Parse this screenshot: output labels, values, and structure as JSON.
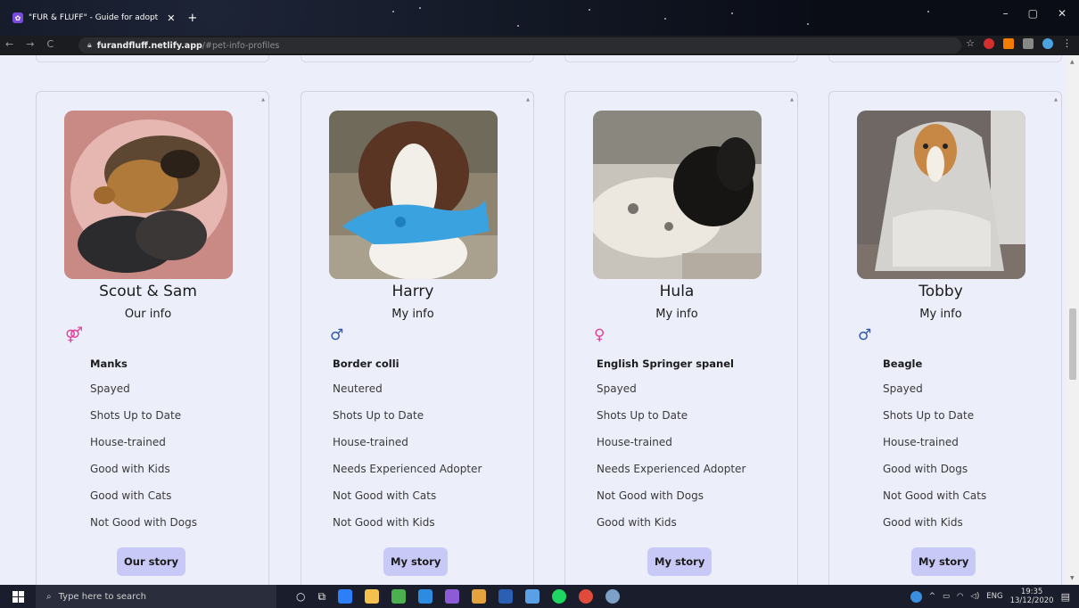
{
  "browser": {
    "tab_title": "\"FUR & FLUFF\" - Guide for adopt",
    "tab_close": "✕",
    "new_tab": "+",
    "url_host": "furandfluff.netlify.app",
    "url_path": "/#pet-info-profiles",
    "window_controls": [
      "–",
      "▢",
      "✕"
    ],
    "nav_icons": [
      "back-icon",
      "forward-icon",
      "reload-icon"
    ]
  },
  "pets": [
    {
      "name": "Scout & Sam",
      "info_title": "Our info",
      "gender_symbol": "⚤",
      "gender": "female-pair",
      "breed": "Manks",
      "traits": [
        "Spayed",
        "Shots Up to Date",
        "House-trained",
        "Good with Kids",
        "Good with Cats",
        "Not Good with Dogs"
      ],
      "story_label": "Our story"
    },
    {
      "name": "Harry",
      "info_title": "My info",
      "gender_symbol": "♂",
      "gender": "male",
      "breed": "Border colli",
      "traits": [
        "Neutered",
        "Shots Up to Date",
        "House-trained",
        "Needs Experienced Adopter",
        "Not Good with Cats",
        "Not Good with Kids"
      ],
      "story_label": "My story"
    },
    {
      "name": "Hula",
      "info_title": "My info",
      "gender_symbol": "♀",
      "gender": "female",
      "breed": "English Springer spanel",
      "traits": [
        "Spayed",
        "Shots Up to Date",
        "House-trained",
        "Needs Experienced Adopter",
        "Not Good with Dogs",
        "Good with Kids"
      ],
      "story_label": "My story"
    },
    {
      "name": "Tobby",
      "info_title": "My info",
      "gender_symbol": "♂",
      "gender": "male",
      "breed": "Beagle",
      "traits": [
        "Spayed",
        "Shots Up to Date",
        "House-trained",
        "Good with Dogs",
        "Not Good with Cats",
        "Good with Kids"
      ],
      "story_label": "My story"
    }
  ],
  "taskbar": {
    "search_placeholder": "Type here to search",
    "lang": "ENG",
    "time": "19:35",
    "date": "13/12/2020"
  },
  "colors": {
    "page_bg": "#eceefa",
    "button_bg": "#c8c9f6",
    "male": "#2f59b0",
    "female": "#e0449b"
  }
}
